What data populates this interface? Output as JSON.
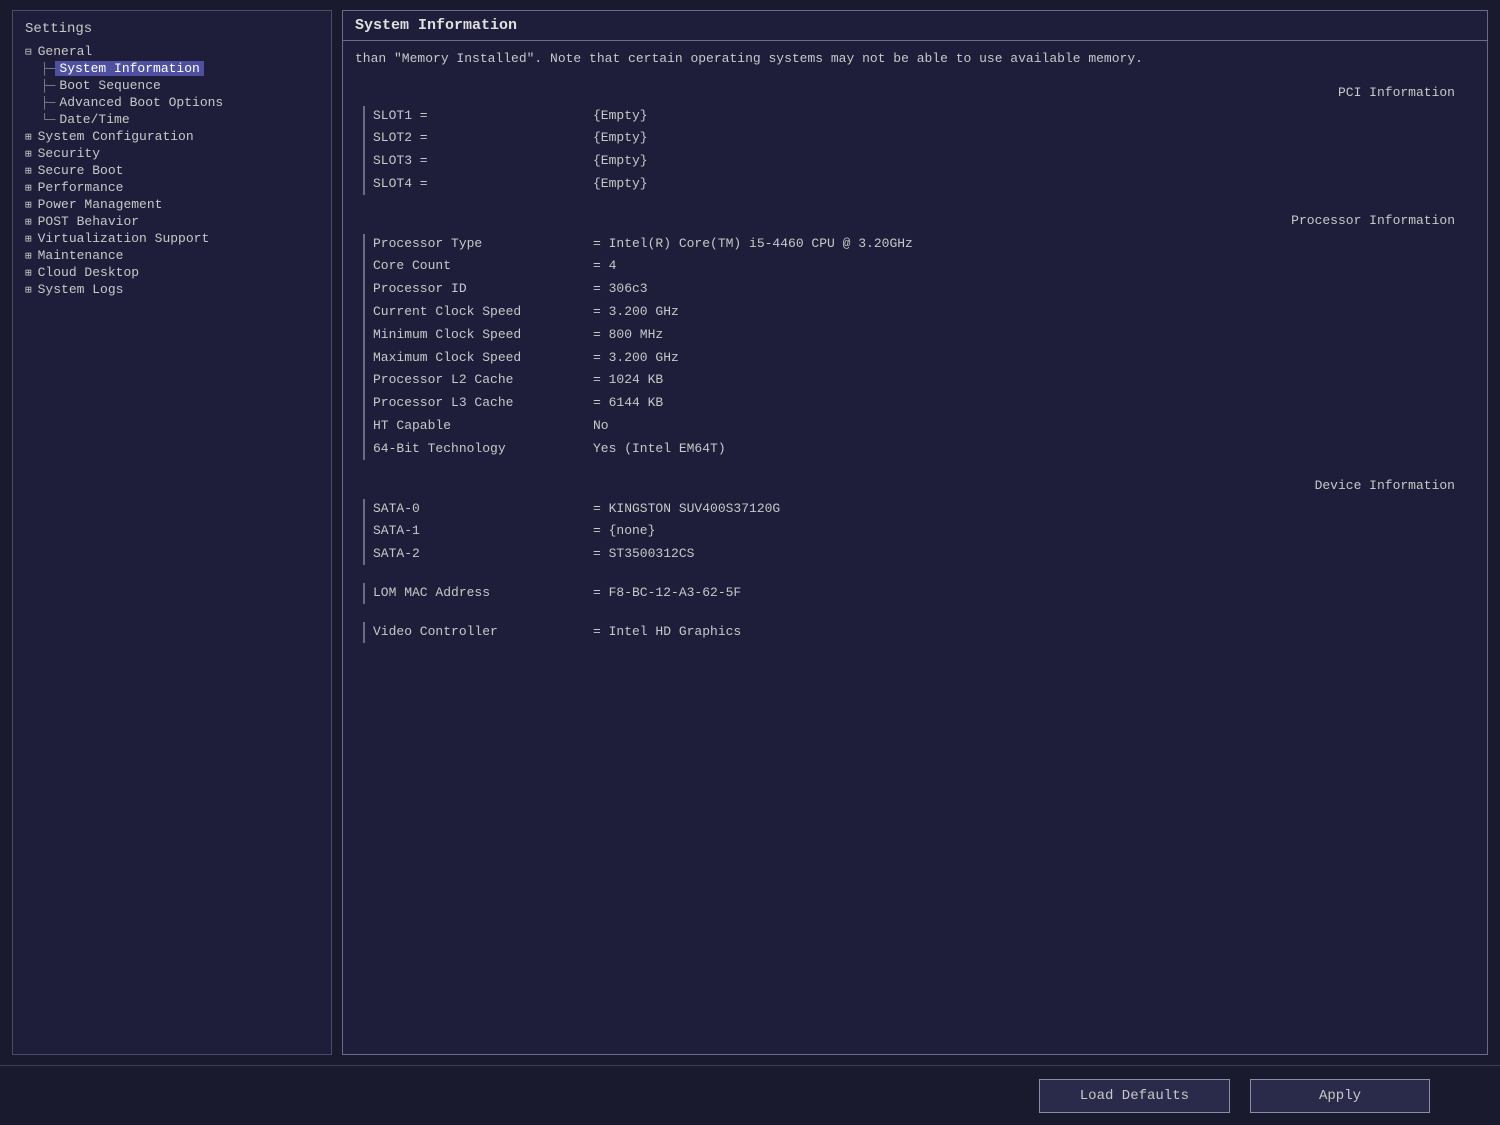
{
  "sidebar": {
    "title": "Settings",
    "items": [
      {
        "id": "general",
        "label": "General",
        "indent": 1,
        "type": "group",
        "icon": "⊟"
      },
      {
        "id": "system-information",
        "label": "System Information",
        "indent": 2,
        "type": "leaf",
        "selected": true,
        "connector": "├─"
      },
      {
        "id": "boot-sequence",
        "label": "Boot Sequence",
        "indent": 2,
        "type": "leaf",
        "connector": "├─"
      },
      {
        "id": "advanced-boot-options",
        "label": "Advanced Boot Options",
        "indent": 2,
        "type": "leaf",
        "connector": "├─"
      },
      {
        "id": "date-time",
        "label": "Date/Time",
        "indent": 2,
        "type": "leaf",
        "connector": "└─"
      },
      {
        "id": "system-configuration",
        "label": "System Configuration",
        "indent": 1,
        "type": "group",
        "icon": "⊞"
      },
      {
        "id": "security",
        "label": "Security",
        "indent": 1,
        "type": "group",
        "icon": "⊞"
      },
      {
        "id": "secure-boot",
        "label": "Secure Boot",
        "indent": 1,
        "type": "group",
        "icon": "⊞"
      },
      {
        "id": "performance",
        "label": "Performance",
        "indent": 1,
        "type": "group",
        "icon": "⊞"
      },
      {
        "id": "power-management",
        "label": "Power Management",
        "indent": 1,
        "type": "group",
        "icon": "⊞"
      },
      {
        "id": "post-behavior",
        "label": "POST Behavior",
        "indent": 1,
        "type": "group",
        "icon": "⊞"
      },
      {
        "id": "virtualization-support",
        "label": "Virtualization Support",
        "indent": 1,
        "type": "group",
        "icon": "⊞"
      },
      {
        "id": "maintenance",
        "label": "Maintenance",
        "indent": 1,
        "type": "group",
        "icon": "⊞"
      },
      {
        "id": "cloud-desktop",
        "label": "Cloud Desktop",
        "indent": 1,
        "type": "group",
        "icon": "⊞"
      },
      {
        "id": "system-logs",
        "label": "System Logs",
        "indent": 1,
        "type": "group",
        "icon": "⊞"
      }
    ]
  },
  "content": {
    "title": "System Information",
    "note": "than \"Memory Installed\". Note that certain operating systems may not be able to use available memory.",
    "pci_section": {
      "title": "PCI Information",
      "slots": [
        {
          "label": "SLOT1 =",
          "value": "{Empty}"
        },
        {
          "label": "SLOT2 =",
          "value": "{Empty}"
        },
        {
          "label": "SLOT3 =",
          "value": "{Empty}"
        },
        {
          "label": "SLOT4 =",
          "value": "{Empty}"
        }
      ]
    },
    "processor_section": {
      "title": "Processor Information",
      "fields": [
        {
          "label": "Processor Type",
          "value": "= Intel(R) Core(TM) i5-4460 CPU @ 3.20GHz"
        },
        {
          "label": "Core Count",
          "value": "= 4"
        },
        {
          "label": "Processor ID",
          "value": "= 306c3"
        },
        {
          "label": "Current Clock Speed",
          "value": "= 3.200 GHz"
        },
        {
          "label": "Minimum Clock Speed",
          "value": "= 800 MHz"
        },
        {
          "label": "Maximum Clock Speed",
          "value": "= 3.200 GHz"
        },
        {
          "label": "Processor L2 Cache",
          "value": "= 1024 KB"
        },
        {
          "label": "Processor L3 Cache",
          "value": "= 6144 KB"
        },
        {
          "label": "HT Capable",
          "value": "No"
        },
        {
          "label": "64-Bit Technology",
          "value": "Yes (Intel EM64T)"
        }
      ]
    },
    "device_section": {
      "title": "Device Information",
      "fields": [
        {
          "label": "SATA-0",
          "value": "= KINGSTON SUV400S37120G"
        },
        {
          "label": "SATA-1",
          "value": "= {none}"
        },
        {
          "label": "SATA-2",
          "value": "= ST3500312CS"
        }
      ]
    },
    "network_section": {
      "fields": [
        {
          "label": "LOM MAC Address",
          "value": "= F8-BC-12-A3-62-5F"
        }
      ]
    },
    "video_section": {
      "fields": [
        {
          "label": "Video Controller",
          "value": "= Intel HD Graphics"
        }
      ]
    }
  },
  "buttons": {
    "load_defaults": "Load Defaults",
    "apply": "Apply"
  }
}
